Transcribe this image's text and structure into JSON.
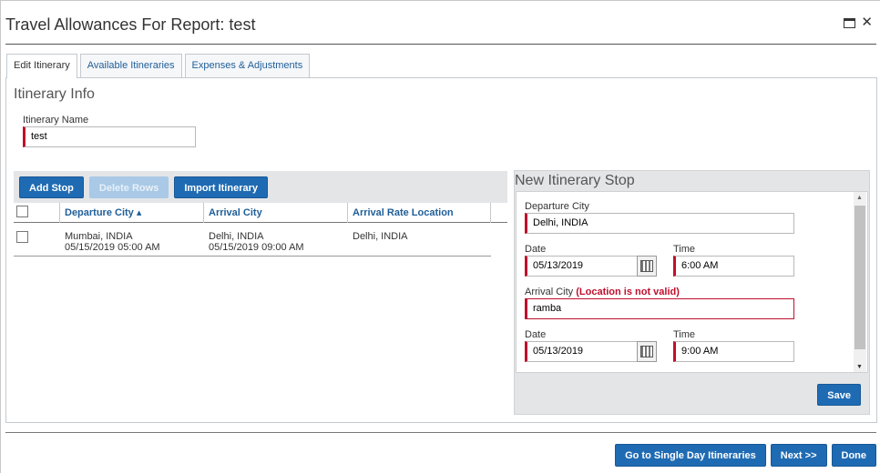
{
  "dialog": {
    "title": "Travel Allowances For Report: test"
  },
  "tabs": [
    {
      "label": "Edit Itinerary",
      "active": true
    },
    {
      "label": "Available Itineraries",
      "active": false
    },
    {
      "label": "Expenses & Adjustments",
      "active": false
    }
  ],
  "itinerary_info": {
    "title": "Itinerary Info",
    "name_label": "Itinerary Name",
    "name_value": "test"
  },
  "toolbar": {
    "add_stop": "Add Stop",
    "delete_rows": "Delete Rows",
    "import_itinerary": "Import Itinerary"
  },
  "grid": {
    "columns": [
      "Departure City ▴",
      "Arrival City",
      "Arrival Rate Location"
    ],
    "rows": [
      {
        "departure_city": "Mumbai, INDIA",
        "departure_time": "05/15/2019 05:00 AM",
        "arrival_city": "Delhi, INDIA",
        "arrival_time": "05/15/2019 09:00 AM",
        "rate_location": "Delhi, INDIA"
      }
    ]
  },
  "new_stop": {
    "title": "New Itinerary Stop",
    "departure_city_label": "Departure City",
    "departure_city_value": "Delhi, INDIA",
    "date_label": "Date",
    "time_label": "Time",
    "departure_date": "05/13/2019",
    "departure_time": "6:00 AM",
    "arrival_city_label": "Arrival City",
    "arrival_city_error": "(Location is not valid)",
    "arrival_city_value": "ramba",
    "arrival_date": "05/13/2019",
    "arrival_time": "9:00 AM",
    "save": "Save"
  },
  "footer": {
    "single_day": "Go to Single Day Itineraries",
    "next": "Next >>",
    "done": "Done"
  },
  "colors": {
    "primary_button": "#1f6bb3",
    "required_marker": "#c00f2d",
    "link": "#1f5e99"
  }
}
